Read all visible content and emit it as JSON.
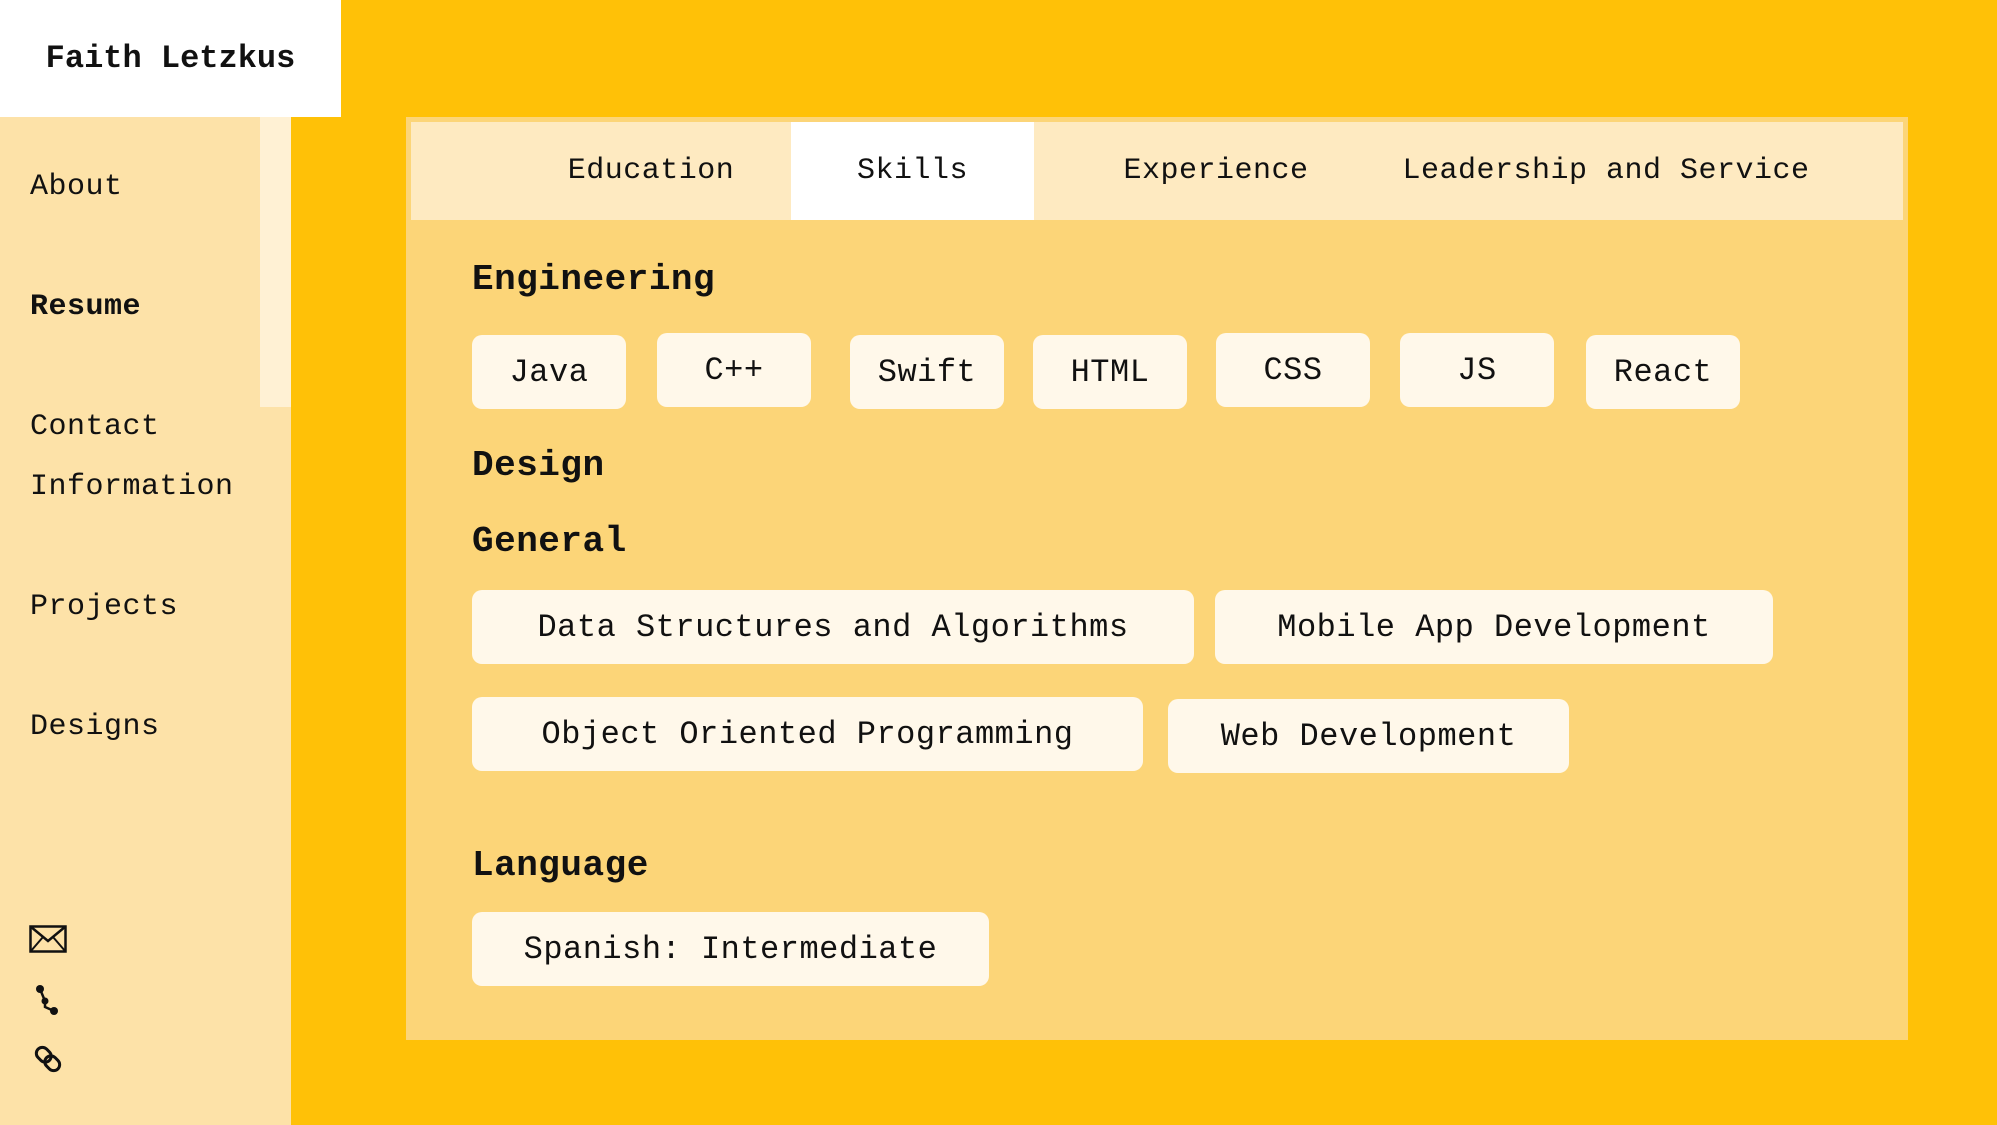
{
  "header": {
    "name": "Faith Letzkus"
  },
  "sidebar": {
    "items": [
      {
        "label": "About"
      },
      {
        "label": "Resume"
      },
      {
        "label": "Contact Information"
      },
      {
        "label": "Projects"
      },
      {
        "label": "Designs"
      }
    ],
    "icons": [
      "mail-icon",
      "git-branch-icon",
      "link-icon"
    ]
  },
  "tabs": [
    {
      "label": "Education"
    },
    {
      "label": "Skills"
    },
    {
      "label": "Experience"
    },
    {
      "label": "Leadership and Service"
    }
  ],
  "skills": {
    "engineering": {
      "title": "Engineering",
      "items": [
        "Java",
        "C++",
        "Swift",
        "HTML",
        "CSS",
        "JS",
        "React"
      ]
    },
    "design": {
      "title": "Design"
    },
    "general": {
      "title": "General",
      "items": [
        "Data Structures and Algorithms",
        "Mobile App Development",
        "Object Oriented Programming",
        "Web Development"
      ]
    },
    "language": {
      "title": "Language",
      "items": [
        "Spanish: Intermediate"
      ]
    }
  },
  "colors": {
    "page_background": "#FFC107",
    "sidebar_background": "#FDE2A8",
    "panel_background": "#FCD578",
    "tab_bar_background": "#FEEAC1",
    "chip_background": "#FFF8EA"
  }
}
